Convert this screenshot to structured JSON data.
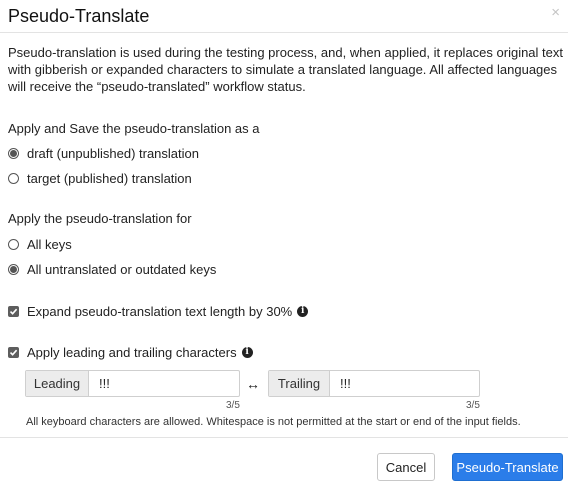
{
  "dialog": {
    "title": "Pseudo-Translate",
    "close_icon": "×"
  },
  "description": "Pseudo-translation is used during the testing process, and, when applied, it replaces original text with gibberish or expanded characters to simulate a translated language. All affected languages will receive the “pseudo-translated” workflow status.",
  "save_as": {
    "label": "Apply and Save the pseudo-translation as a",
    "options": [
      {
        "label": "draft (unpublished) translation",
        "checked": true
      },
      {
        "label": "target (published) translation",
        "checked": false
      }
    ]
  },
  "apply_for": {
    "label": "Apply the pseudo-translation for",
    "options": [
      {
        "label": "All keys",
        "checked": false
      },
      {
        "label": "All untranslated or outdated keys",
        "checked": true
      }
    ]
  },
  "expand": {
    "label": "Expand pseudo-translation text length by 30%",
    "checked": true,
    "icon": "info-icon"
  },
  "leading_trailing": {
    "label": "Apply leading and trailing characters",
    "checked": true,
    "icon": "info-icon",
    "leading": {
      "addon": "Leading",
      "value": "!!!",
      "counter": "3/5"
    },
    "arrow": "↔",
    "trailing": {
      "addon": "Trailing",
      "value": "!!!",
      "counter": "3/5"
    },
    "hint": "All keyboard characters are allowed. Whitespace is not permitted at the start or end of the input fields."
  },
  "footer": {
    "cancel_label": "Cancel",
    "primary_label": "Pseudo-Translate"
  },
  "colors": {
    "primary": "#2b7de9",
    "control": "#5d5d5d"
  }
}
